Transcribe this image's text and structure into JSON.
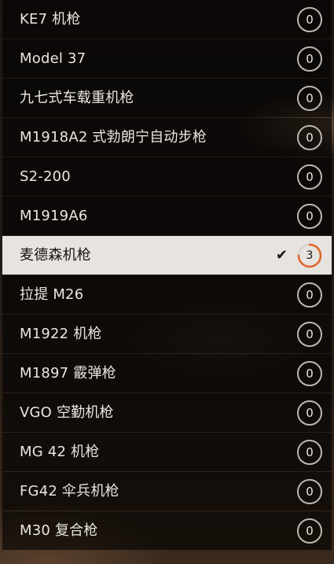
{
  "accent_color": "#e0662a",
  "items": [
    {
      "label": "KE7 机枪",
      "count": "0",
      "selected": false
    },
    {
      "label": "Model 37",
      "count": "0",
      "selected": false
    },
    {
      "label": "九七式车载重机枪",
      "count": "0",
      "selected": false
    },
    {
      "label": "M1918A2 式勃朗宁自动步枪",
      "count": "0",
      "selected": false
    },
    {
      "label": "S2-200",
      "count": "0",
      "selected": false
    },
    {
      "label": "M1919A6",
      "count": "0",
      "selected": false
    },
    {
      "label": "麦德森机枪",
      "count": "3",
      "selected": true,
      "progress": 0.75,
      "check_icon": "checkmark-icon"
    },
    {
      "label": "拉提 M26",
      "count": "0",
      "selected": false
    },
    {
      "label": "M1922 机枪",
      "count": "0",
      "selected": false
    },
    {
      "label": "M1897 霰弹枪",
      "count": "0",
      "selected": false
    },
    {
      "label": "VGO 空勤机枪",
      "count": "0",
      "selected": false
    },
    {
      "label": "MG 42 机枪",
      "count": "0",
      "selected": false
    },
    {
      "label": "FG42 伞兵机枪",
      "count": "0",
      "selected": false
    },
    {
      "label": "M30 复合枪",
      "count": "0",
      "selected": false
    }
  ]
}
